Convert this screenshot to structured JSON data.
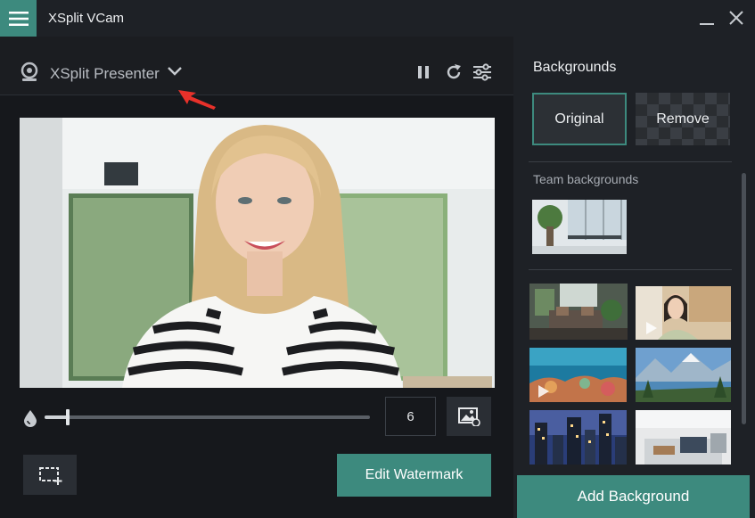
{
  "app": {
    "title": "XSplit VCam"
  },
  "toolbar": {
    "device_name": "XSplit Presenter"
  },
  "controls": {
    "blur_value": "6",
    "blur_level": 0.07,
    "edit_watermark_label": "Edit Watermark"
  },
  "backgrounds": {
    "title": "Backgrounds",
    "original_label": "Original",
    "remove_label": "Remove",
    "team_label": "Team backgrounds",
    "add_label": "Add Background"
  },
  "colors": {
    "accent": "#3d8a7e",
    "panel": "#1e2126",
    "background": "#16181c",
    "annotation_arrow": "#e8312a"
  }
}
